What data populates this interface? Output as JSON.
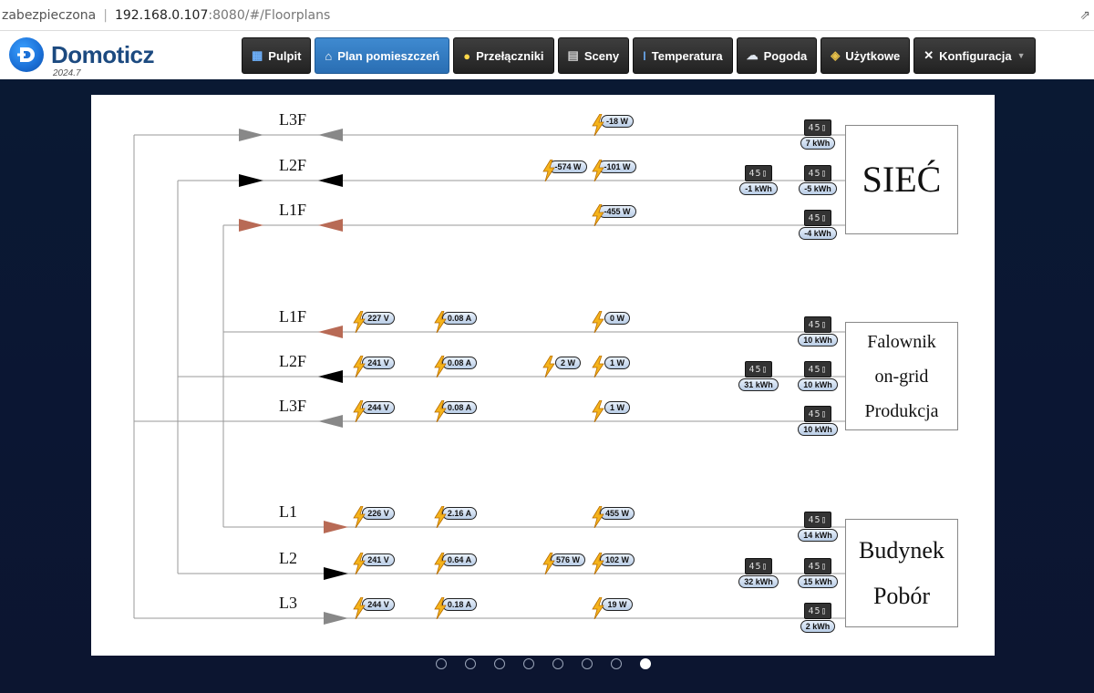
{
  "browser": {
    "security": "zabezpieczona",
    "host": "192.168.0.107",
    "path": ":8080/#/Floorplans"
  },
  "app": {
    "name": "Domoticz",
    "version": "2024.7"
  },
  "nav": [
    {
      "label": "Pulpit",
      "icon": "dashboard-icon",
      "active": false
    },
    {
      "label": "Plan pomieszczeń",
      "icon": "floorplan-icon",
      "active": true
    },
    {
      "label": "Przełączniki",
      "icon": "lightbulb-icon",
      "active": false
    },
    {
      "label": "Sceny",
      "icon": "scene-icon",
      "active": false
    },
    {
      "label": "Temperatura",
      "icon": "thermometer-icon",
      "active": false
    },
    {
      "label": "Pogoda",
      "icon": "weather-icon",
      "active": false
    },
    {
      "label": "Użytkowe",
      "icon": "utility-icon",
      "active": false
    },
    {
      "label": "Konfiguracja",
      "icon": "tools-icon",
      "active": false
    }
  ],
  "groups": [
    {
      "name": "sieć",
      "box_lines": [
        "SIEĆ"
      ],
      "lines": [
        {
          "label": "L3F",
          "color": "#888888",
          "readings": [
            {
              "col": "p3",
              "value": "-18 W"
            },
            {
              "col": "e2",
              "value": "7 kWh"
            }
          ]
        },
        {
          "label": "L2F",
          "color": "#000000",
          "readings": [
            {
              "col": "p2",
              "value": "-574 W"
            },
            {
              "col": "p3",
              "value": "-101 W"
            },
            {
              "col": "e1",
              "value": "-1 kWh"
            },
            {
              "col": "e2",
              "value": "-5 kWh"
            }
          ]
        },
        {
          "label": "L1F",
          "color": "#b86a55",
          "readings": [
            {
              "col": "p3",
              "value": "-455 W"
            },
            {
              "col": "e2",
              "value": "-4 kWh"
            }
          ]
        }
      ]
    },
    {
      "name": "falownik",
      "box_lines": [
        "Falownik",
        "on-grid",
        "Produkcja"
      ],
      "lines": [
        {
          "label": "L1F",
          "color": "#b86a55",
          "readings": [
            {
              "col": "v",
              "value": "227 V"
            },
            {
              "col": "a",
              "value": "0.08 A"
            },
            {
              "col": "p3",
              "value": "0 W"
            },
            {
              "col": "e2",
              "value": "10 kWh"
            }
          ]
        },
        {
          "label": "L2F",
          "color": "#000000",
          "readings": [
            {
              "col": "v",
              "value": "241 V"
            },
            {
              "col": "a",
              "value": "0.08 A"
            },
            {
              "col": "p2",
              "value": "2 W"
            },
            {
              "col": "p3",
              "value": "1 W"
            },
            {
              "col": "e1",
              "value": "31 kWh"
            },
            {
              "col": "e2",
              "value": "10 kWh"
            }
          ]
        },
        {
          "label": "L3F",
          "color": "#888888",
          "readings": [
            {
              "col": "v",
              "value": "244 V"
            },
            {
              "col": "a",
              "value": "0.08 A"
            },
            {
              "col": "p3",
              "value": "1 W"
            },
            {
              "col": "e2",
              "value": "10 kWh"
            }
          ]
        }
      ]
    },
    {
      "name": "budynek",
      "box_lines": [
        "Budynek",
        "Pobór"
      ],
      "lines": [
        {
          "label": "L1",
          "color": "#b86a55",
          "readings": [
            {
              "col": "v",
              "value": "226 V"
            },
            {
              "col": "a",
              "value": "2.16 A"
            },
            {
              "col": "p3",
              "value": "455 W"
            },
            {
              "col": "e2",
              "value": "14 kWh"
            }
          ]
        },
        {
          "label": "L2",
          "color": "#000000",
          "readings": [
            {
              "col": "v",
              "value": "241 V"
            },
            {
              "col": "a",
              "value": "0.64 A"
            },
            {
              "col": "p2",
              "value": "576 W"
            },
            {
              "col": "p3",
              "value": "102 W"
            },
            {
              "col": "e1",
              "value": "32 kWh"
            },
            {
              "col": "e2",
              "value": "15 kWh"
            }
          ]
        },
        {
          "label": "L3",
          "color": "#888888",
          "readings": [
            {
              "col": "v",
              "value": "244 V"
            },
            {
              "col": "a",
              "value": "0.18 A"
            },
            {
              "col": "p3",
              "value": "19 W"
            },
            {
              "col": "e2",
              "value": "2 kWh"
            }
          ]
        }
      ]
    }
  ],
  "meter_digits": "45",
  "pager": {
    "count": 8,
    "active": 7
  }
}
